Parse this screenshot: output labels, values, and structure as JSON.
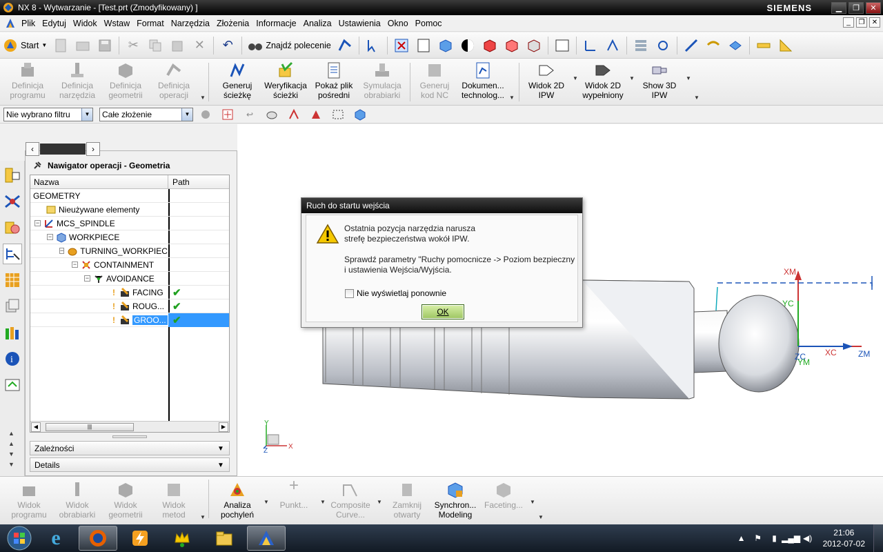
{
  "window": {
    "title": "NX 8 - Wytwarzanie - [Test.prt (Zmodyfikowany) ]",
    "brand": "SIEMENS"
  },
  "menu": [
    "Plik",
    "Edytuj",
    "Widok",
    "Wstaw",
    "Format",
    "Narzędzia",
    "Złożenia",
    "Informacje",
    "Analiza",
    "Ustawienia",
    "Okno",
    "Pomoc"
  ],
  "toolbar1": {
    "start_label": "Start",
    "find_command_label": "Znajdź polecenie"
  },
  "toolbar2": {
    "buttons": [
      {
        "label": "Definicja\nprogramu",
        "enabled": false
      },
      {
        "label": "Definicja\nnarzędzia",
        "enabled": false
      },
      {
        "label": "Definicja\ngeometrii",
        "enabled": false
      },
      {
        "label": "Definicja\noperacji",
        "enabled": false
      },
      {
        "label": "Generuj\nścieżkę",
        "enabled": true
      },
      {
        "label": "Weryfikacja\nścieżki",
        "enabled": true
      },
      {
        "label": "Pokaż plik\npośredni",
        "enabled": true
      },
      {
        "label": "Symulacja\nobrabiarki",
        "enabled": false
      },
      {
        "label": "Generuj\nkod NC",
        "enabled": false
      },
      {
        "label": "Dokumen...\ntechnolog...",
        "enabled": true
      },
      {
        "label": "Widok 2D\nIPW",
        "enabled": true
      },
      {
        "label": "Widok 2D\nwypełniony",
        "enabled": true
      },
      {
        "label": "Show 3D\nIPW",
        "enabled": true
      }
    ]
  },
  "filterbar": {
    "filter_value": "Nie wybrano filtru",
    "scope_value": "Całe złożenie"
  },
  "navigator": {
    "title": "Nawigator operacji - Geometria",
    "columns": [
      "Nazwa",
      "Path"
    ],
    "rows": [
      {
        "name": "GEOMETRY",
        "level": 0,
        "icon": "none",
        "path": ""
      },
      {
        "name": "Nieużywane elementy",
        "level": 1,
        "icon": "unused-items-icon",
        "path": ""
      },
      {
        "name": "MCS_SPINDLE",
        "level": 1,
        "icon": "mcs-icon",
        "path": ""
      },
      {
        "name": "WORKPIECE",
        "level": 2,
        "icon": "workpiece-icon",
        "path": ""
      },
      {
        "name": "TURNING_WORKPIECE",
        "level": 3,
        "icon": "turning-workpiece-icon",
        "path": ""
      },
      {
        "name": "CONTAINMENT",
        "level": 4,
        "icon": "containment-icon",
        "path": ""
      },
      {
        "name": "AVOIDANCE",
        "level": 5,
        "icon": "avoidance-icon",
        "path": ""
      },
      {
        "name": "FACING",
        "level": 6,
        "icon": "operation-icon",
        "path": "ok"
      },
      {
        "name": "ROUG...",
        "level": 6,
        "icon": "operation-icon",
        "path": "ok"
      },
      {
        "name": "GROO...",
        "level": 6,
        "icon": "operation-icon",
        "path": "ok",
        "selected": true
      }
    ],
    "sections": [
      "Zależności",
      "Details"
    ]
  },
  "dialog": {
    "title": "Ruch do startu wejścia",
    "line1": "Ostatnia pozycja narzędzia narusza",
    "line2": "strefę bezpieczeństwa wokół IPW.",
    "line3": "Sprawdź parametry \"Ruchy pomocnicze -> Poziom bezpieczny",
    "line4": "i ustawienia Wejścia/Wyjścia.",
    "checkbox_label": "Nie wyświetlaj ponownie",
    "checkbox_checked": false,
    "ok_label": "OK"
  },
  "csys": {
    "xm": "XM",
    "yc": "YC",
    "xc": "XC",
    "zm": "ZM",
    "zc": "ZC",
    "ym": "YM",
    "triad_y": "Y",
    "triad_x": "X",
    "triad_z": "Z"
  },
  "toolbar3": {
    "buttons": [
      {
        "label": "Widok\nprogramu",
        "enabled": false
      },
      {
        "label": "Widok\nobrabiarki",
        "enabled": false
      },
      {
        "label": "Widok\ngeometrii",
        "enabled": false
      },
      {
        "label": "Widok\nmetod",
        "enabled": false
      },
      {
        "label": "Analiza\npochyleń",
        "enabled": true
      },
      {
        "label": "Punkt...",
        "enabled": false
      },
      {
        "label": "Composite\nCurve...",
        "enabled": false
      },
      {
        "label": "Zamknij\notwarty",
        "enabled": false
      },
      {
        "label": "Synchron...\nModeling",
        "enabled": true
      },
      {
        "label": "Faceting...",
        "enabled": false
      }
    ]
  },
  "taskbar": {
    "time": "21:06",
    "date": "2012-07-02"
  }
}
